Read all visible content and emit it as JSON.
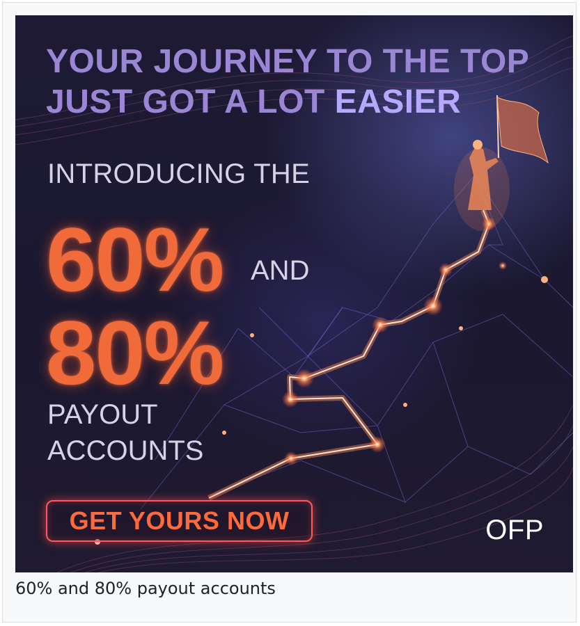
{
  "banner": {
    "headline": {
      "line1": "YOUR JOURNEY TO THE TOP",
      "line2_start": "JUST GOT A LOT ",
      "line2_accent": "EASIER"
    },
    "intro": "INTRODUCING THE",
    "big_first": "60%",
    "connector": "AND",
    "big_second": "80%",
    "payout_line1": "PAYOUT",
    "payout_line2": "ACCOUNTS",
    "cta_label": "GET YOURS NOW",
    "brand": "OFP",
    "colors": {
      "background": "#1e1a35",
      "headline": "#9b86d6",
      "headline_accent": "#b6a8ff",
      "highlight": "#f06a3a",
      "cta_border": "#ff5a5a",
      "body_text": "#d6d3e6"
    },
    "icons": [
      "flag-figure-icon",
      "mountain-path-icon"
    ]
  },
  "caption": "60% and 80% payout accounts"
}
